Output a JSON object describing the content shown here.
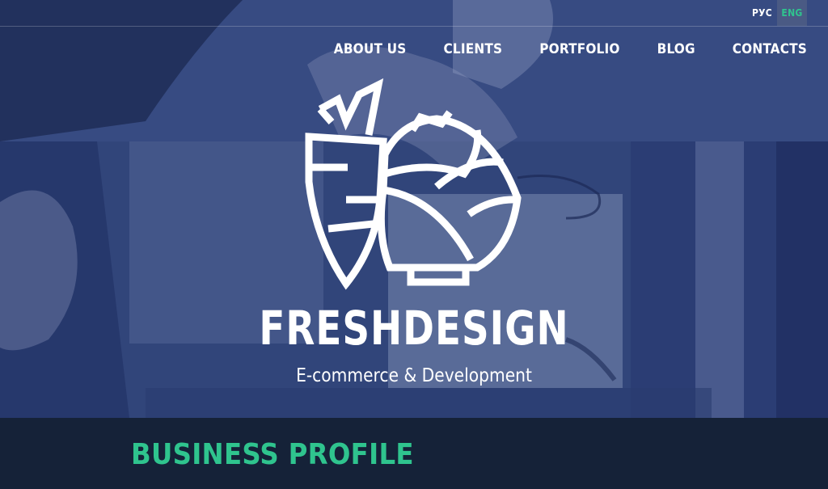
{
  "language_switch": {
    "ru": "РУС",
    "en": "ENG",
    "active": "ENG"
  },
  "nav": {
    "items": [
      {
        "label": "ABOUT US"
      },
      {
        "label": "CLIENTS"
      },
      {
        "label": "PORTFOLIO"
      },
      {
        "label": "BLOG"
      },
      {
        "label": "CONTACTS"
      }
    ]
  },
  "hero": {
    "logo_icon": "carrot-artichoke-icon",
    "brand": "FRESHDESIGN",
    "tagline": "E-commerce & Development"
  },
  "section": {
    "title": "BUSINESS PROFILE"
  },
  "colors": {
    "hero_overlay": "#33477d",
    "accent": "#2fc48e",
    "dark_band": "#152238",
    "text": "#ffffff"
  }
}
